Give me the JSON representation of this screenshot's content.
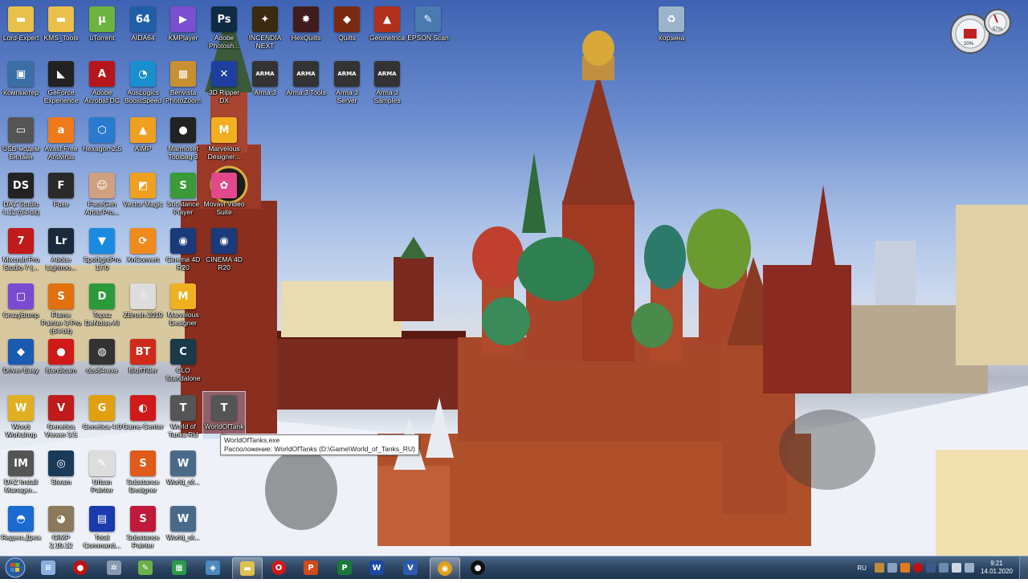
{
  "desktop": {
    "icons": [
      {
        "label": "Lord-Expert",
        "icon": "folder-icon",
        "color": "#e8c04a",
        "glyph": "▬"
      },
      {
        "label": "KMS_Tools",
        "icon": "folder-icon",
        "color": "#e8c04a",
        "glyph": "▬"
      },
      {
        "label": "uTorrent",
        "icon": "utorrent-icon",
        "color": "#6db33f",
        "glyph": "µ"
      },
      {
        "label": "AIDA64",
        "icon": "aida64-icon",
        "color": "#1f5fa8",
        "glyph": "64"
      },
      {
        "label": "KMPlayer",
        "icon": "kmplayer-icon",
        "color": "#7a4fd0",
        "glyph": "▶"
      },
      {
        "label": "Adobe Photosh...",
        "icon": "photoshop-icon",
        "color": "#0f2a44",
        "glyph": "Ps"
      },
      {
        "label": "INCENDIA NEXT",
        "icon": "incendia-icon",
        "color": "#3a2a10",
        "glyph": "✦"
      },
      {
        "label": "HexQuilts",
        "icon": "hexquilts-icon",
        "color": "#401c1c",
        "glyph": "✸"
      },
      {
        "label": "Quilts",
        "icon": "quilts-icon",
        "color": "#7a2a10",
        "glyph": "◆"
      },
      {
        "label": "Geometrica",
        "icon": "geometrica-icon",
        "color": "#b0301a",
        "glyph": "▲"
      },
      {
        "label": "EPSON Scan",
        "icon": "epson-scan-icon",
        "color": "#4a7ab0",
        "glyph": "✎"
      },
      {
        "label": "Компьютер",
        "icon": "computer-icon",
        "color": "#3b6ea5",
        "glyph": "▣"
      },
      {
        "label": "GeForce Experience",
        "icon": "geforce-icon",
        "color": "#222",
        "glyph": "◣"
      },
      {
        "label": "Adobe Acrobat DC",
        "icon": "acrobat-icon",
        "color": "#b5161b",
        "glyph": "A"
      },
      {
        "label": "AusLogics BoostSpeed",
        "icon": "auslogics-icon",
        "color": "#1a8fd0",
        "glyph": "◔"
      },
      {
        "label": "Benvista PhotoZoom",
        "icon": "photozoom-icon",
        "color": "#c89030",
        "glyph": "▦"
      },
      {
        "label": "3D Ripper DX",
        "icon": "ripper-icon",
        "color": "#1f3fa0",
        "glyph": "✕"
      },
      {
        "label": "Arma 3",
        "icon": "arma-icon",
        "color": "#333",
        "glyph": "ARMA"
      },
      {
        "label": "Arma 3 Tools",
        "icon": "arma-tools-icon",
        "color": "#333",
        "glyph": "ARMA"
      },
      {
        "label": "Arma 3 Server",
        "icon": "arma-server-icon",
        "color": "#333",
        "glyph": "ARMA"
      },
      {
        "label": "Arma 3 Samples",
        "icon": "arma-samples-icon",
        "color": "#333",
        "glyph": "ARMA"
      },
      {
        "label": "USB-модем Билайн",
        "icon": "usb-modem-icon",
        "color": "#555",
        "glyph": "▭"
      },
      {
        "label": "Avast Free Antivirus",
        "icon": "avast-icon",
        "color": "#f07a1a",
        "glyph": "a"
      },
      {
        "label": "Hexagon 2.5",
        "icon": "hexagon-icon",
        "color": "#2a7ad0",
        "glyph": "⬡"
      },
      {
        "label": "AIMP",
        "icon": "aimp-icon",
        "color": "#f0a020",
        "glyph": "▲"
      },
      {
        "label": "Marmoset Toolbag 3",
        "icon": "marmoset-icon",
        "color": "#222",
        "glyph": "●"
      },
      {
        "label": "Marvelous Designer...",
        "icon": "marvelous-icon",
        "color": "#f0b020",
        "glyph": "M"
      },
      {
        "label": "DAZ Studio 4.12 (64-bit)",
        "icon": "daz-studio-icon",
        "color": "#222",
        "glyph": "DS"
      },
      {
        "label": "Fuse",
        "icon": "fuse-icon",
        "color": "#2a2a2a",
        "glyph": "F"
      },
      {
        "label": "FaceGen Artist Pro...",
        "icon": "facegen-icon",
        "color": "#d0a080",
        "glyph": "☺"
      },
      {
        "label": "Vector Magic",
        "icon": "vector-magic-icon",
        "color": "#f0a020",
        "glyph": "◩"
      },
      {
        "label": "Substance Player",
        "icon": "substance-player-icon",
        "color": "#3a9a3a",
        "glyph": "S"
      },
      {
        "label": "Movavi Video Suite",
        "icon": "movavi-icon",
        "color": "#e04a8a",
        "glyph": "✿"
      },
      {
        "label": "Mixcraft Pro Studio 7 (...",
        "icon": "mixcraft-icon",
        "color": "#c01a1a",
        "glyph": "7"
      },
      {
        "label": "Adobe Lightroo...",
        "icon": "lightroom-icon",
        "color": "#1a2a3a",
        "glyph": "Lr"
      },
      {
        "label": "SpotlightPro 17.0",
        "icon": "spotlight-icon",
        "color": "#1a8ae0",
        "glyph": "▼"
      },
      {
        "label": "XnConvert",
        "icon": "xnconvert-icon",
        "color": "#f08a1a",
        "glyph": "⟳"
      },
      {
        "label": "Cinema 4D R20",
        "icon": "cinema4d-icon",
        "color": "#1a3a7a",
        "glyph": "◉"
      },
      {
        "label": "CINEMA 4D R20",
        "icon": "cinema4d-alt-icon",
        "color": "#1a3a7a",
        "glyph": "◉"
      },
      {
        "label": "CrazyBump",
        "icon": "crazybump-icon",
        "color": "#7a4ad0",
        "glyph": "▢"
      },
      {
        "label": "Flame Painter 3 Pro (64-bit)",
        "icon": "flame-painter-icon",
        "color": "#e07010",
        "glyph": "S"
      },
      {
        "label": "Topaz DeNoise AI",
        "icon": "topaz-icon",
        "color": "#2a9a3a",
        "glyph": "D"
      },
      {
        "label": "ZBrush 2019",
        "icon": "zbrush-icon",
        "color": "#ddd",
        "glyph": "☃"
      },
      {
        "label": "Marvelous Designer",
        "icon": "marvelous-designer-icon",
        "color": "#f0b020",
        "glyph": "M"
      },
      {
        "label": "Driver Easy",
        "icon": "driver-easy-icon",
        "color": "#1a5ab0",
        "glyph": "◆"
      },
      {
        "label": "Bandicam",
        "icon": "bandicam-icon",
        "color": "#d01a1a",
        "glyph": "●"
      },
      {
        "label": "obs64.exe",
        "icon": "obs-icon",
        "color": "#333",
        "glyph": "◍"
      },
      {
        "label": "BluffTitler",
        "icon": "blufftitler-icon",
        "color": "#d02a1a",
        "glyph": "BT"
      },
      {
        "label": "CLO Standalone",
        "icon": "clo-icon",
        "color": "#1a3a4a",
        "glyph": "C"
      },
      {
        "label": "Wood Workshop",
        "icon": "wood-workshop-icon",
        "color": "#e0b020",
        "glyph": "W"
      },
      {
        "label": "Genetica Viewer 3.5",
        "icon": "genetica-viewer-icon",
        "color": "#c01a1a",
        "glyph": "V"
      },
      {
        "label": "Genetica 4.0",
        "icon": "genetica-icon",
        "color": "#e0a010",
        "glyph": "G"
      },
      {
        "label": "Game Center",
        "icon": "game-center-icon",
        "color": "#d01a1a",
        "glyph": "◐"
      },
      {
        "label": "World of Tanks RU",
        "icon": "wot-icon",
        "color": "#555",
        "glyph": "T"
      },
      {
        "label": "WorldOfTanks",
        "icon": "wot-exe-icon",
        "color": "#555",
        "glyph": "T"
      },
      {
        "label": "DAZ Install Manager...",
        "icon": "daz-install-icon",
        "color": "#555",
        "glyph": "IM"
      },
      {
        "label": "Steam",
        "icon": "steam-icon",
        "color": "#1a3a5a",
        "glyph": "◎"
      },
      {
        "label": "Urban Painter",
        "icon": "urban-painter-icon",
        "color": "#ddd",
        "glyph": "✎"
      },
      {
        "label": "Substance Designer",
        "icon": "substance-designer-icon",
        "color": "#e05a1a",
        "glyph": "S"
      },
      {
        "label": "World_of...",
        "icon": "wot-shortcut-icon",
        "color": "#4a6a8a",
        "glyph": "W"
      },
      {
        "label": "Яндекс.Диск",
        "icon": "yandex-disk-icon",
        "color": "#1a6ad0",
        "glyph": "◓"
      },
      {
        "label": "GIMP 2.10.12",
        "icon": "gimp-icon",
        "color": "#8a7a5a",
        "glyph": "◕"
      },
      {
        "label": "Total Command...",
        "icon": "total-commander-icon",
        "color": "#1a3ab0",
        "glyph": "▤"
      },
      {
        "label": "Substance Painter",
        "icon": "substance-painter-icon",
        "color": "#c01a3a",
        "glyph": "S"
      },
      {
        "label": "World_of...",
        "icon": "wot-shortcut2-icon",
        "color": "#4a6a8a",
        "glyph": "W"
      },
      {
        "label": "Корзина",
        "icon": "recycle-bin-icon",
        "color": "#9ab4cc",
        "glyph": "♻"
      }
    ],
    "tooltip": {
      "line1": "WorldOfTanks.exe",
      "line2": "Расположение: WorldOfTanks (D:\\Game\\World_of_Tanks_RU)"
    },
    "gadget": {
      "cpu": "20%",
      "mem": "57%"
    }
  },
  "taskbar": {
    "start_icon": "windows-start-icon",
    "pinned": [
      {
        "icon": "notepad-icon",
        "color": "#8ab0e0",
        "glyph": "≡"
      },
      {
        "icon": "record-icon",
        "color": "#c01010",
        "glyph": "●"
      },
      {
        "icon": "tools-icon",
        "color": "#8a9ab0",
        "glyph": "✲"
      },
      {
        "icon": "notepadpp-icon",
        "color": "#6ab04a",
        "glyph": "✎"
      },
      {
        "icon": "spreadsheet-icon",
        "color": "#2a9a4a",
        "glyph": "▦"
      },
      {
        "icon": "virtual-drive-icon",
        "color": "#4a8ac0",
        "glyph": "◈"
      },
      {
        "icon": "explorer-icon",
        "color": "#e0c050",
        "glyph": "▬"
      },
      {
        "icon": "opera-icon",
        "color": "#d01a1a",
        "glyph": "O"
      },
      {
        "icon": "powerpoint-icon",
        "color": "#d04a1a",
        "glyph": "P"
      },
      {
        "icon": "project-icon",
        "color": "#1a7a3a",
        "glyph": "P"
      },
      {
        "icon": "word-icon",
        "color": "#1a4aa0",
        "glyph": "W"
      },
      {
        "icon": "visio-icon",
        "color": "#2a5ab0",
        "glyph": "V"
      },
      {
        "icon": "chrome-icon",
        "color": "#e0a020",
        "glyph": "◉"
      },
      {
        "icon": "obs-record-icon",
        "color": "#111",
        "glyph": "●"
      }
    ],
    "lang": "RU",
    "time": "9:21",
    "date": "14.01.2020"
  }
}
